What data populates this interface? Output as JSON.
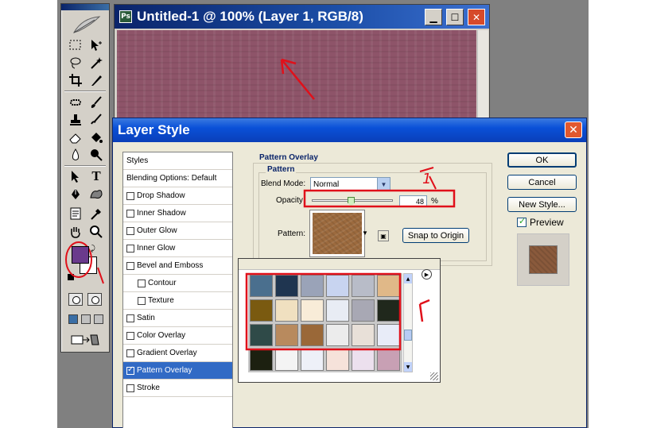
{
  "document": {
    "title": "Untitled-1 @ 100% (Layer 1, RGB/8)",
    "icon": "photoshop-doc-icon",
    "canvas_color": "#8e5469"
  },
  "toolbox": {
    "foreground_color": "#6a3a8c",
    "background_color": "#ffffff",
    "type_tool_label": "T"
  },
  "dialog": {
    "title": "Layer Style",
    "styles_header": "Styles",
    "style_items": [
      {
        "label": "Blending Options: Default",
        "checkbox": false,
        "checked": false,
        "selected": false,
        "indent": false
      },
      {
        "label": "Drop Shadow",
        "checkbox": true,
        "checked": false,
        "selected": false,
        "indent": false
      },
      {
        "label": "Inner Shadow",
        "checkbox": true,
        "checked": false,
        "selected": false,
        "indent": false
      },
      {
        "label": "Outer Glow",
        "checkbox": true,
        "checked": false,
        "selected": false,
        "indent": false
      },
      {
        "label": "Inner Glow",
        "checkbox": true,
        "checked": false,
        "selected": false,
        "indent": false
      },
      {
        "label": "Bevel and Emboss",
        "checkbox": true,
        "checked": false,
        "selected": false,
        "indent": false
      },
      {
        "label": "Contour",
        "checkbox": true,
        "checked": false,
        "selected": false,
        "indent": true
      },
      {
        "label": "Texture",
        "checkbox": true,
        "checked": false,
        "selected": false,
        "indent": true
      },
      {
        "label": "Satin",
        "checkbox": true,
        "checked": false,
        "selected": false,
        "indent": false
      },
      {
        "label": "Color Overlay",
        "checkbox": true,
        "checked": false,
        "selected": false,
        "indent": false
      },
      {
        "label": "Gradient Overlay",
        "checkbox": true,
        "checked": false,
        "selected": false,
        "indent": false
      },
      {
        "label": "Pattern Overlay",
        "checkbox": true,
        "checked": true,
        "selected": true,
        "indent": false
      },
      {
        "label": "Stroke",
        "checkbox": true,
        "checked": false,
        "selected": false,
        "indent": false
      }
    ],
    "section_title": "Pattern Overlay",
    "group_title": "Pattern",
    "blend_mode_label": "Blend Mode:",
    "blend_mode_value": "Normal",
    "opacity_label": "Opacity",
    "opacity_value": "48",
    "opacity_fraction": 0.48,
    "opacity_unit": "%",
    "pattern_label": "Pattern:",
    "snap_button": "Snap to Origin",
    "ok_button": "OK",
    "cancel_button": "Cancel",
    "new_style_button": "New Style...",
    "preview_label": "Preview",
    "preview_checked": true
  },
  "picker": {
    "swatches": [
      [
        "#4a6f8e",
        "#1f3550",
        "#9aa3b8",
        "#c8d4f0",
        "#b8bcc8",
        "#e0b888"
      ],
      [
        "#7a5a10",
        "#f0e0c0",
        "#f8ecd8",
        "#e8ecf4",
        "#a8a8b4",
        "#20281c"
      ],
      [
        "#2f4a48",
        "#b88a5e",
        "#9a6838",
        "#ececec",
        "#e8e0d8",
        "#e8ecf8"
      ],
      [
        "#1c2010",
        "#f4f4f4",
        "#eef0f8",
        "#f6e2da",
        "#ece0ee",
        "#c8a0b4"
      ]
    ]
  },
  "annotations": {
    "number_label": "1"
  }
}
